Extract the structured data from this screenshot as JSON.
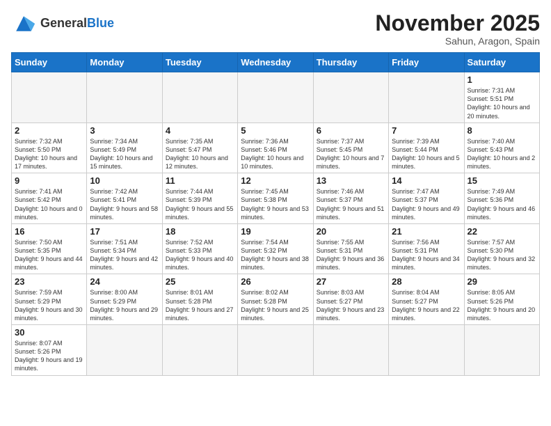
{
  "header": {
    "logo_general": "General",
    "logo_blue": "Blue",
    "month_title": "November 2025",
    "location": "Sahun, Aragon, Spain"
  },
  "days_of_week": [
    "Sunday",
    "Monday",
    "Tuesday",
    "Wednesday",
    "Thursday",
    "Friday",
    "Saturday"
  ],
  "weeks": [
    [
      {
        "day": "",
        "info": ""
      },
      {
        "day": "",
        "info": ""
      },
      {
        "day": "",
        "info": ""
      },
      {
        "day": "",
        "info": ""
      },
      {
        "day": "",
        "info": ""
      },
      {
        "day": "",
        "info": ""
      },
      {
        "day": "1",
        "info": "Sunrise: 7:31 AM\nSunset: 5:51 PM\nDaylight: 10 hours and 20 minutes."
      }
    ],
    [
      {
        "day": "2",
        "info": "Sunrise: 7:32 AM\nSunset: 5:50 PM\nDaylight: 10 hours and 17 minutes."
      },
      {
        "day": "3",
        "info": "Sunrise: 7:34 AM\nSunset: 5:49 PM\nDaylight: 10 hours and 15 minutes."
      },
      {
        "day": "4",
        "info": "Sunrise: 7:35 AM\nSunset: 5:47 PM\nDaylight: 10 hours and 12 minutes."
      },
      {
        "day": "5",
        "info": "Sunrise: 7:36 AM\nSunset: 5:46 PM\nDaylight: 10 hours and 10 minutes."
      },
      {
        "day": "6",
        "info": "Sunrise: 7:37 AM\nSunset: 5:45 PM\nDaylight: 10 hours and 7 minutes."
      },
      {
        "day": "7",
        "info": "Sunrise: 7:39 AM\nSunset: 5:44 PM\nDaylight: 10 hours and 5 minutes."
      },
      {
        "day": "8",
        "info": "Sunrise: 7:40 AM\nSunset: 5:43 PM\nDaylight: 10 hours and 2 minutes."
      }
    ],
    [
      {
        "day": "9",
        "info": "Sunrise: 7:41 AM\nSunset: 5:42 PM\nDaylight: 10 hours and 0 minutes."
      },
      {
        "day": "10",
        "info": "Sunrise: 7:42 AM\nSunset: 5:41 PM\nDaylight: 9 hours and 58 minutes."
      },
      {
        "day": "11",
        "info": "Sunrise: 7:44 AM\nSunset: 5:39 PM\nDaylight: 9 hours and 55 minutes."
      },
      {
        "day": "12",
        "info": "Sunrise: 7:45 AM\nSunset: 5:38 PM\nDaylight: 9 hours and 53 minutes."
      },
      {
        "day": "13",
        "info": "Sunrise: 7:46 AM\nSunset: 5:37 PM\nDaylight: 9 hours and 51 minutes."
      },
      {
        "day": "14",
        "info": "Sunrise: 7:47 AM\nSunset: 5:37 PM\nDaylight: 9 hours and 49 minutes."
      },
      {
        "day": "15",
        "info": "Sunrise: 7:49 AM\nSunset: 5:36 PM\nDaylight: 9 hours and 46 minutes."
      }
    ],
    [
      {
        "day": "16",
        "info": "Sunrise: 7:50 AM\nSunset: 5:35 PM\nDaylight: 9 hours and 44 minutes."
      },
      {
        "day": "17",
        "info": "Sunrise: 7:51 AM\nSunset: 5:34 PM\nDaylight: 9 hours and 42 minutes."
      },
      {
        "day": "18",
        "info": "Sunrise: 7:52 AM\nSunset: 5:33 PM\nDaylight: 9 hours and 40 minutes."
      },
      {
        "day": "19",
        "info": "Sunrise: 7:54 AM\nSunset: 5:32 PM\nDaylight: 9 hours and 38 minutes."
      },
      {
        "day": "20",
        "info": "Sunrise: 7:55 AM\nSunset: 5:31 PM\nDaylight: 9 hours and 36 minutes."
      },
      {
        "day": "21",
        "info": "Sunrise: 7:56 AM\nSunset: 5:31 PM\nDaylight: 9 hours and 34 minutes."
      },
      {
        "day": "22",
        "info": "Sunrise: 7:57 AM\nSunset: 5:30 PM\nDaylight: 9 hours and 32 minutes."
      }
    ],
    [
      {
        "day": "23",
        "info": "Sunrise: 7:59 AM\nSunset: 5:29 PM\nDaylight: 9 hours and 30 minutes."
      },
      {
        "day": "24",
        "info": "Sunrise: 8:00 AM\nSunset: 5:29 PM\nDaylight: 9 hours and 29 minutes."
      },
      {
        "day": "25",
        "info": "Sunrise: 8:01 AM\nSunset: 5:28 PM\nDaylight: 9 hours and 27 minutes."
      },
      {
        "day": "26",
        "info": "Sunrise: 8:02 AM\nSunset: 5:28 PM\nDaylight: 9 hours and 25 minutes."
      },
      {
        "day": "27",
        "info": "Sunrise: 8:03 AM\nSunset: 5:27 PM\nDaylight: 9 hours and 23 minutes."
      },
      {
        "day": "28",
        "info": "Sunrise: 8:04 AM\nSunset: 5:27 PM\nDaylight: 9 hours and 22 minutes."
      },
      {
        "day": "29",
        "info": "Sunrise: 8:05 AM\nSunset: 5:26 PM\nDaylight: 9 hours and 20 minutes."
      }
    ],
    [
      {
        "day": "30",
        "info": "Sunrise: 8:07 AM\nSunset: 5:26 PM\nDaylight: 9 hours and 19 minutes."
      },
      {
        "day": "",
        "info": ""
      },
      {
        "day": "",
        "info": ""
      },
      {
        "day": "",
        "info": ""
      },
      {
        "day": "",
        "info": ""
      },
      {
        "day": "",
        "info": ""
      },
      {
        "day": "",
        "info": ""
      }
    ]
  ]
}
